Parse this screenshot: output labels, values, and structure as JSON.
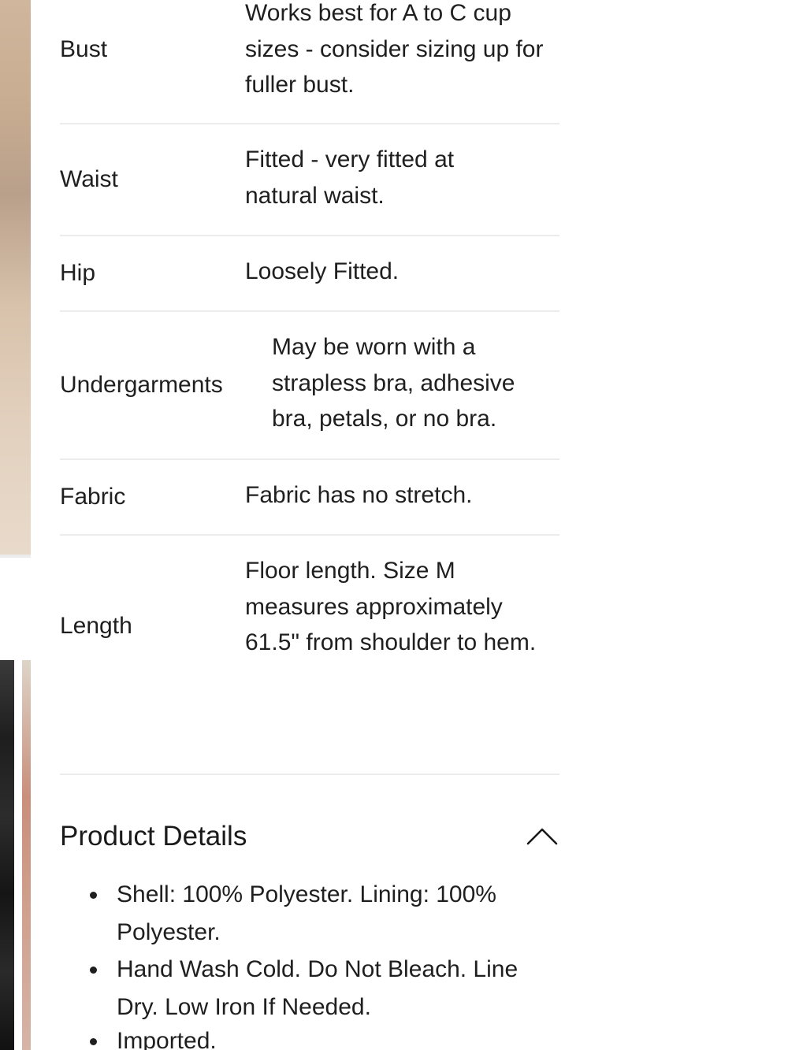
{
  "fit_table": {
    "rows": [
      {
        "label": "Bust",
        "value": "Works best for A to C cup sizes - consider sizing up for fuller bust."
      },
      {
        "label": "Waist",
        "value": "Fitted - very fitted at natural waist."
      },
      {
        "label": "Hip",
        "value": "Loosely Fitted."
      },
      {
        "label": "Undergarments",
        "value": "May be worn with a strapless bra, adhesive bra, petals, or no bra."
      },
      {
        "label": "Fabric",
        "value": "Fabric has no stretch."
      },
      {
        "label": "Length",
        "value": "Floor length. Size M measures approximately 61.5\" from shoulder to hem."
      }
    ]
  },
  "product_details": {
    "title": "Product Details",
    "toggle_icon": "chevron-up-icon",
    "items": [
      "Shell: 100% Polyester. Lining: 100% Polyester.",
      "Hand Wash Cold. Do Not Bleach. Line Dry. Low Iron If Needed.",
      "Imported."
    ]
  },
  "colors": {
    "text": "#1f1f1f",
    "divider": "#ececec",
    "background": "#ffffff"
  }
}
